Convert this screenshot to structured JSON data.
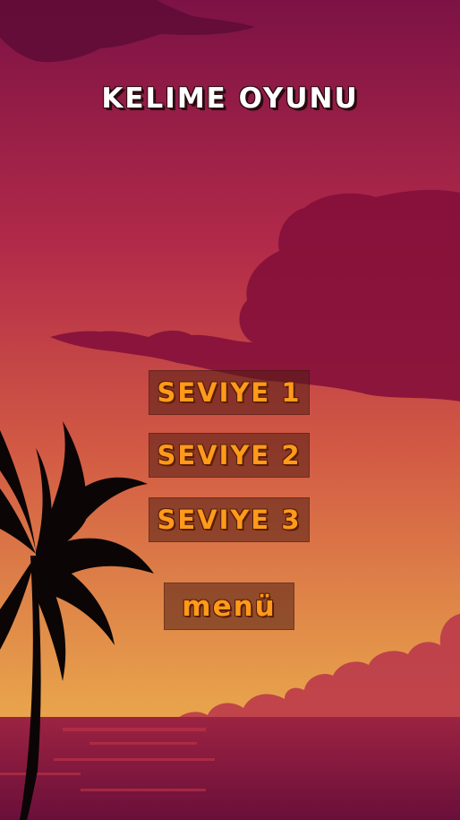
{
  "title": "KELIME OYUNU",
  "levels": [
    "SEVIYE 1",
    "SEVIYE 2",
    "SEVIYE 3"
  ],
  "menu_label": "menü",
  "colors": {
    "sky_top": "#7c1245",
    "sky_mid": "#c84048",
    "sky_low": "#e29a4a",
    "sea": "#8a1640",
    "button_text": "#ff9a1a",
    "button_bg": "#5a2414"
  }
}
